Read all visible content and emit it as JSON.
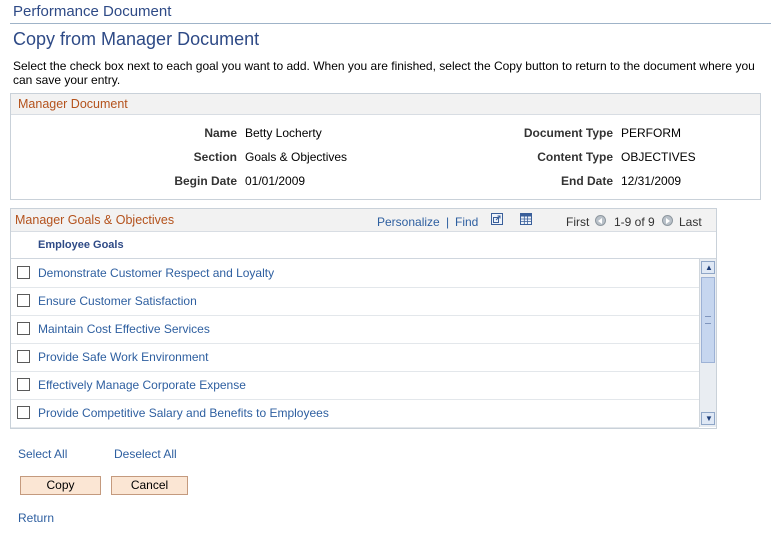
{
  "breadcrumb": "Performance Document",
  "page_title": "Copy from Manager Document",
  "instructions": "Select the check box next to each goal you want to add. When you are finished, select the Copy button to return to the document where you can save your entry.",
  "manager_document": {
    "title": "Manager Document",
    "fields": {
      "name_label": "Name",
      "name_value": "Betty Locherty",
      "section_label": "Section",
      "section_value": "Goals & Objectives",
      "begin_label": "Begin Date",
      "begin_value": "01/01/2009",
      "doc_type_label": "Document Type",
      "doc_type_value": "PERFORM",
      "content_type_label": "Content Type",
      "content_type_value": "OBJECTIVES",
      "end_label": "End Date",
      "end_value": "12/31/2009"
    }
  },
  "grid": {
    "title": "Manager Goals & Objectives",
    "personalize": "Personalize",
    "separator": "|",
    "find": "Find",
    "first": "First",
    "range": "1-9 of 9",
    "last": "Last",
    "column_header": "Employee Goals",
    "rows": [
      {
        "label": "Demonstrate Customer Respect and Loyalty",
        "checked": false
      },
      {
        "label": "Ensure Customer Satisfaction",
        "checked": false
      },
      {
        "label": "Maintain Cost Effective Services",
        "checked": false
      },
      {
        "label": "Provide Safe Work Environment",
        "checked": false
      },
      {
        "label": "Effectively Manage Corporate Expense",
        "checked": false
      },
      {
        "label": "Provide Competitive Salary and Benefits to Employees",
        "checked": false
      }
    ],
    "icons": {
      "view_all": "new-window-icon",
      "download": "spreadsheet-icon",
      "prev": "previous-arrow-icon",
      "next": "next-arrow-icon"
    }
  },
  "actions": {
    "select_all": "Select All",
    "deselect_all": "Deselect All",
    "copy": "Copy",
    "cancel": "Cancel",
    "return": "Return"
  },
  "colors": {
    "link": "#2e5fa0",
    "title": "#2e4a86",
    "section_title": "#b4521c",
    "button_bg": "#fbe6d4"
  }
}
